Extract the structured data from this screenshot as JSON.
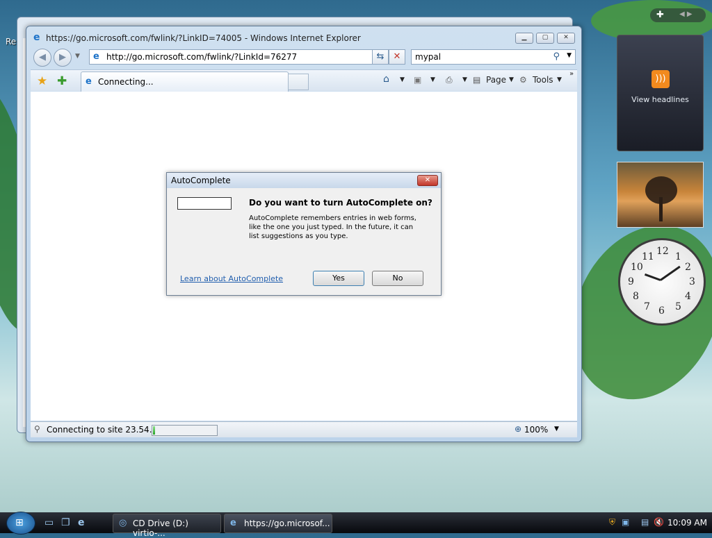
{
  "desktop": {
    "partial_label": "Re"
  },
  "ie": {
    "title": "https://go.microsoft.com/fwlink/?LinkID=74005 - Windows Internet Explorer",
    "address": "http://go.microsoft.com/fwlink/?LinkId=76277",
    "search_value": "mypal",
    "tab_label": "Connecting...",
    "toolbar": {
      "page_label": "Page",
      "tools_label": "Tools"
    },
    "status_text": "Connecting to site 23.54.70...",
    "progress": 0.03,
    "zoom": "100%"
  },
  "dialog": {
    "title": "AutoComplete",
    "question": "Do you want to turn AutoComplete on?",
    "description": "AutoComplete remembers entries in web forms, like the one you just typed. In the future, it can list suggestions as you type.",
    "learn_link": "Learn about AutoComplete",
    "yes_label": "Yes",
    "no_label": "No",
    "input_value": ""
  },
  "sidebar": {
    "feeds_label": "View headlines"
  },
  "clock": {
    "numerals": [
      "12",
      "1",
      "2",
      "3",
      "4",
      "5",
      "6",
      "7",
      "8",
      "9",
      "10",
      "11"
    ]
  },
  "taskbar": {
    "tasks": [
      {
        "label": "CD Drive (D:) virtio-..."
      },
      {
        "label": "https://go.microsof..."
      }
    ],
    "time": "10:09 AM"
  },
  "colors": {
    "accent": "#1d73c9",
    "close": "#c2362a",
    "link": "#1f5dad"
  }
}
